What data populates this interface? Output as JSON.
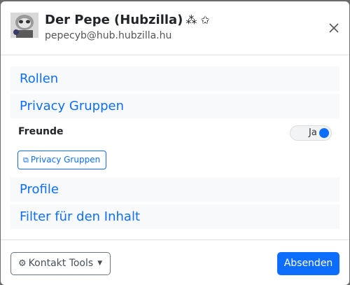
{
  "modal": {
    "title": "Der Pepe (Hubzilla)",
    "title_badges": "⁂ ✩",
    "subtitle": "pepecyb@hub.hubzilla.hu"
  },
  "sections": {
    "roles": "Rollen",
    "privacy_groups": "Privacy Gruppen",
    "profile": "Profile",
    "content_filter": "Filter für den Inhalt"
  },
  "group": {
    "label": "Freunde",
    "toggle_label": "Ja",
    "toggle_on": true
  },
  "privacy_groups_button": "Privacy Gruppen",
  "footer": {
    "tools_label": "Kontakt Tools",
    "submit_label": "Absenden"
  },
  "colors": {
    "accent": "#0d6efd",
    "backdrop": "#6b6b6b"
  }
}
